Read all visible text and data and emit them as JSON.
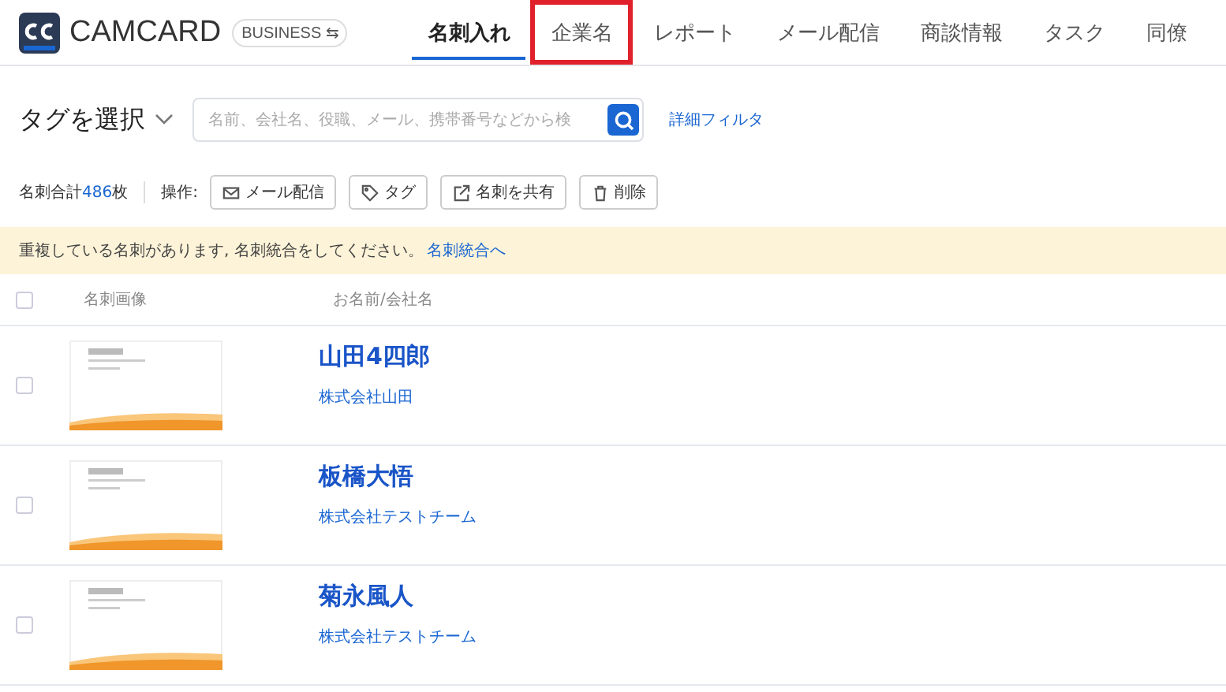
{
  "header": {
    "brand": "CAMCARD",
    "edition": "BUSINESS ⇆",
    "tabs": [
      {
        "label": "名刺入れ",
        "selected": true,
        "highlighted": false
      },
      {
        "label": "企業名",
        "selected": false,
        "highlighted": true
      },
      {
        "label": "レポート",
        "selected": false,
        "highlighted": false
      },
      {
        "label": "メール配信",
        "selected": false,
        "highlighted": false
      },
      {
        "label": "商談情報",
        "selected": false,
        "highlighted": false
      },
      {
        "label": "タスク",
        "selected": false,
        "highlighted": false
      },
      {
        "label": "同僚",
        "selected": false,
        "highlighted": false
      }
    ]
  },
  "filter": {
    "tag_select": "タグを選択",
    "search": {
      "placeholder": "名前、会社名、役職、メール、携帯番号などから検"
    },
    "advanced_filter": "詳細フィルタ"
  },
  "actions": {
    "total_label": "名刺合計",
    "total_count": "486",
    "total_unit": "枚",
    "operations_label": "操作:",
    "buttons": [
      {
        "kind": "mail",
        "label": "メール配信"
      },
      {
        "kind": "tag",
        "label": "タグ"
      },
      {
        "kind": "share",
        "label": "名刺を共有"
      },
      {
        "kind": "delete",
        "label": "削除"
      }
    ]
  },
  "notice": {
    "text": "重複している名刺があります, 名刺統合をしてください。",
    "link": "名刺統合へ"
  },
  "table": {
    "columns": [
      "名刺画像",
      "お名前/会社名"
    ],
    "header_checked": false,
    "rows": [
      {
        "checked": false,
        "name": "山田4四郎",
        "company": "株式会社山田"
      },
      {
        "checked": false,
        "name": "板橋大悟",
        "company": "株式会社テストチーム"
      },
      {
        "checked": false,
        "name": "菊永風人",
        "company": "株式会社テストチーム"
      }
    ]
  }
}
